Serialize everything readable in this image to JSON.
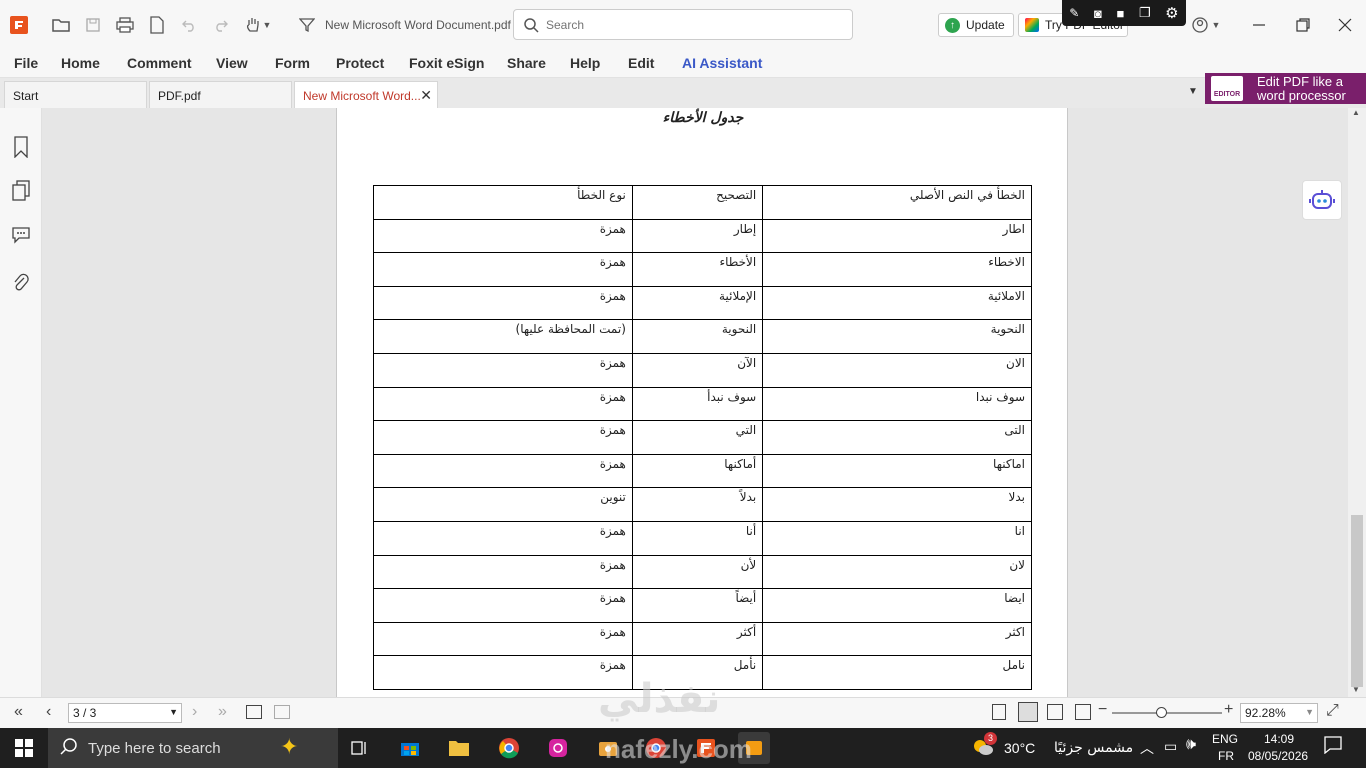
{
  "titlebar": {
    "doc_title": "New Microsoft Word Document.pdf",
    "search_placeholder": "Search",
    "update_label": "Update",
    "try_label": "Try PDF Editor"
  },
  "menu": [
    "File",
    "Home",
    "Comment",
    "View",
    "Form",
    "Protect",
    "Foxit eSign",
    "Share",
    "Help",
    "Edit",
    "AI Assistant"
  ],
  "tabs": [
    {
      "label": "Start"
    },
    {
      "label": "PDF.pdf"
    },
    {
      "label": "New Microsoft Word..."
    }
  ],
  "promo": {
    "line1": "Edit PDF like a",
    "line2": "word processor",
    "badge": "EDITOR"
  },
  "document": {
    "heading": "جدول الأخطاء",
    "table": {
      "headers": [
        "الخطأ في النص الأصلي",
        "التصحيح",
        "نوع الخطأ"
      ],
      "rows": [
        [
          "اطار",
          "إطار",
          "همزة"
        ],
        [
          "الاخطاء",
          "الأخطاء",
          "همزة"
        ],
        [
          "الاملائية",
          "الإملائية",
          "همزة"
        ],
        [
          "النحوية",
          "النحوية",
          "(تمت المحافظة عليها)"
        ],
        [
          "الان",
          "الآن",
          "همزة"
        ],
        [
          "سوف نبدا",
          "سوف نبدأ",
          "همزة"
        ],
        [
          "التى",
          "التي",
          "همزة"
        ],
        [
          "اماكنها",
          "أماكنها",
          "همزة"
        ],
        [
          "بدلا",
          "بدلاً",
          "تنوين"
        ],
        [
          "انا",
          "أنا",
          "همزة"
        ],
        [
          "لان",
          "لأن",
          "همزة"
        ],
        [
          "ايضا",
          "أيضاً",
          "همزة"
        ],
        [
          "اكثر",
          "أكثر",
          "همزة"
        ],
        [
          "نامل",
          "نأمل",
          "همزة"
        ]
      ]
    }
  },
  "statusbar": {
    "page_value": "3 / 3",
    "zoom_value": "92.28%"
  },
  "watermark": {
    "arabic": "نفذلي",
    "latin": "nafezly.com"
  },
  "taskbar": {
    "search_placeholder": "Type here to search",
    "temperature": "30°C",
    "weather_text": "مشمس جزئيًا",
    "weather_badge": "3",
    "lang_top": "ENG",
    "lang_bottom": "FR",
    "time": "14:09",
    "date": "08/05/2026"
  },
  "colors": {
    "accent": "#c0392b",
    "ai_assistant": "#3a58c7",
    "promo_bg": "#7a1f6b",
    "update_green": "#2ea44f",
    "taskbar_bg": "#1f1f1f"
  }
}
